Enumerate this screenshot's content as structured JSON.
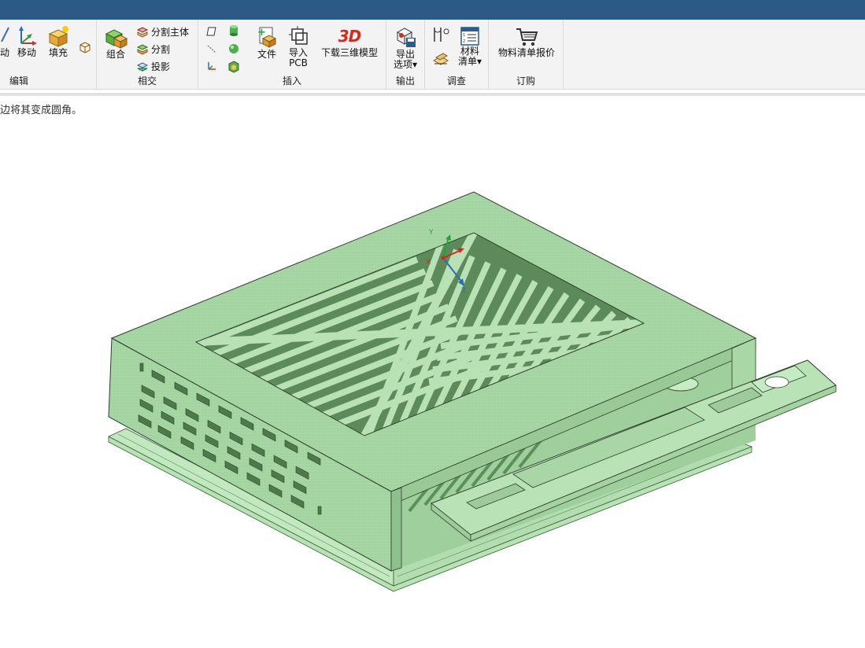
{
  "ribbon": {
    "edit": {
      "label": "编辑",
      "partial_label": "动",
      "move": "移动",
      "fill": "填充"
    },
    "intersect": {
      "label": "相交",
      "combine": "组合",
      "split_body": "分割主体",
      "split": "分割",
      "project": "投影"
    },
    "insert": {
      "label": "插入",
      "file": "文件",
      "import": "导入",
      "pcb": "PCB",
      "download_3d": "下载三维模型",
      "logo_3d": "3D"
    },
    "output": {
      "label": "输出",
      "export_line1": "导出",
      "export_line2": "选项▾"
    },
    "investigate": {
      "label": "调查",
      "bom_line1": "材料",
      "bom_line2": "清单▾"
    },
    "order": {
      "label": "订购",
      "bom_quote": "物料清单报价"
    }
  },
  "status": {
    "hint": "边将其变成圆角。"
  },
  "viewport": {
    "model_color": "#b0dcae",
    "axis": {
      "x": "X",
      "y": "Y",
      "z": "Z"
    }
  }
}
